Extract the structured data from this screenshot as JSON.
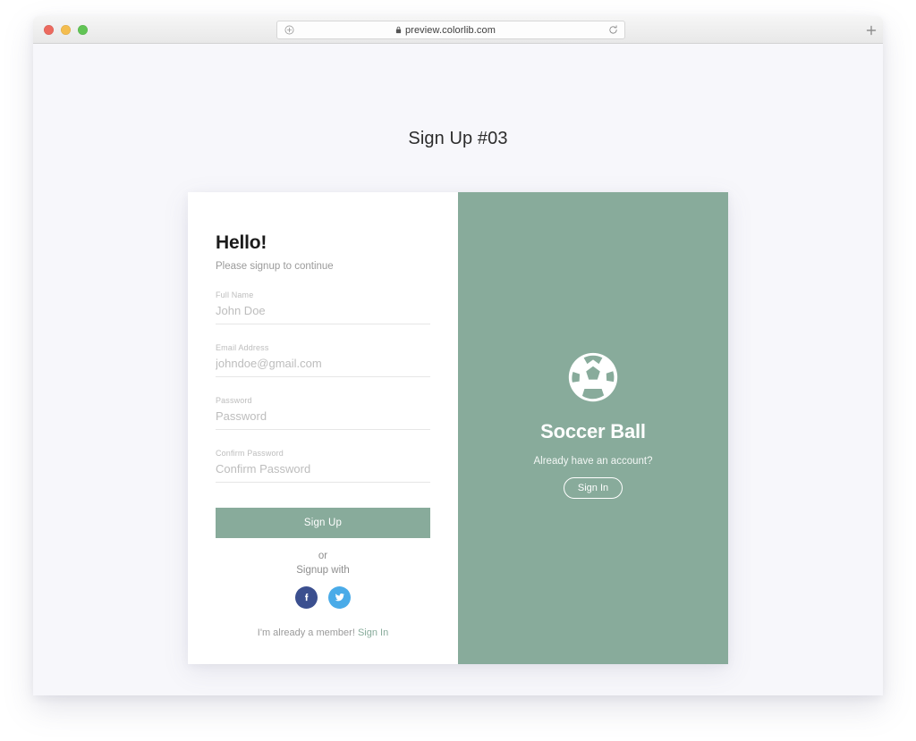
{
  "browser": {
    "url": "preview.colorlib.com",
    "lock_icon": "lock-icon",
    "reload_icon": "reload-icon",
    "add_tab_icon": "plus-icon",
    "traffic_lights": [
      "close-red",
      "minimize-yellow",
      "maximize-green"
    ]
  },
  "page": {
    "title": "Sign Up #03",
    "background_color": "#f7f7fb"
  },
  "form": {
    "heading": "Hello!",
    "subtitle": "Please signup to continue",
    "fields": [
      {
        "label": "Full Name",
        "placeholder": "John Doe",
        "value": "",
        "type": "text"
      },
      {
        "label": "Email Address",
        "placeholder": "johndoe@gmail.com",
        "value": "",
        "type": "email"
      },
      {
        "label": "Password",
        "placeholder": "Password",
        "value": "",
        "type": "password"
      },
      {
        "label": "Confirm Password",
        "placeholder": "Confirm Password",
        "value": "",
        "type": "password"
      }
    ],
    "submit_label": "Sign Up",
    "or_label": "or",
    "signup_with_label": "Signup with",
    "social": [
      {
        "name": "facebook",
        "glyph": "f",
        "color": "#3b4f8f"
      },
      {
        "name": "twitter",
        "glyph": "twitter-bird",
        "color": "#4aabe8"
      }
    ],
    "member_text": "I'm already a member!",
    "member_link": "Sign In"
  },
  "panel": {
    "icon": "soccer-ball-icon",
    "title": "Soccer Ball",
    "prompt": "Already have an account?",
    "signin_label": "Sign In",
    "background_color": "#88ab9b"
  },
  "theme": {
    "accent": "#88ab9b"
  }
}
